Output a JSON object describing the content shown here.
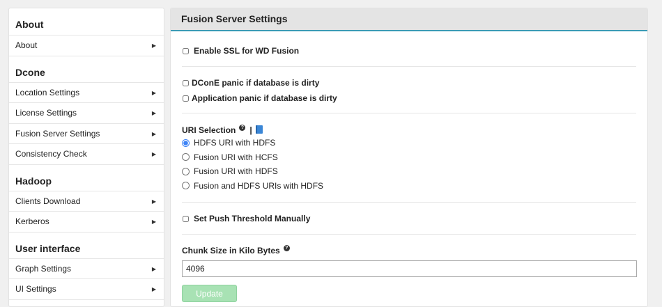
{
  "sidebar": {
    "sections": [
      {
        "heading": "About",
        "items": [
          {
            "label": "About"
          }
        ]
      },
      {
        "heading": "Dcone",
        "items": [
          {
            "label": "Location Settings"
          },
          {
            "label": "License Settings"
          },
          {
            "label": "Fusion Server Settings"
          },
          {
            "label": "Consistency Check"
          }
        ]
      },
      {
        "heading": "Hadoop",
        "items": [
          {
            "label": "Clients Download"
          },
          {
            "label": "Kerberos"
          }
        ]
      },
      {
        "heading": "User interface",
        "items": [
          {
            "label": "Graph Settings"
          },
          {
            "label": "UI Settings"
          }
        ]
      }
    ],
    "arrow_icon": "triangle-right-icon"
  },
  "panel": {
    "title": "Fusion Server Settings",
    "ssl": {
      "label": "Enable SSL for WD Fusion",
      "checked": false
    },
    "dcone_panic": {
      "label": "DConE panic if database is dirty",
      "checked": false
    },
    "app_panic": {
      "label": "Application panic if database is dirty",
      "checked": false
    },
    "uri": {
      "label": "URI Selection",
      "help_icon": "help-icon",
      "separator": "|",
      "doc_icon": "book-icon",
      "options": [
        {
          "label": "HDFS URI with HDFS",
          "selected": true
        },
        {
          "label": "Fusion URI with HCFS",
          "selected": false
        },
        {
          "label": "Fusion URI with HDFS",
          "selected": false
        },
        {
          "label": "Fusion and HDFS URIs with HDFS",
          "selected": false
        }
      ]
    },
    "push_threshold": {
      "label": "Set Push Threshold Manually",
      "checked": false
    },
    "chunk": {
      "label": "Chunk Size in Kilo Bytes",
      "help_icon": "help-icon",
      "value": "4096"
    },
    "update_label": "Update",
    "accent_color": "#3a9bb5",
    "update_button_color": "#a8e2b4"
  }
}
